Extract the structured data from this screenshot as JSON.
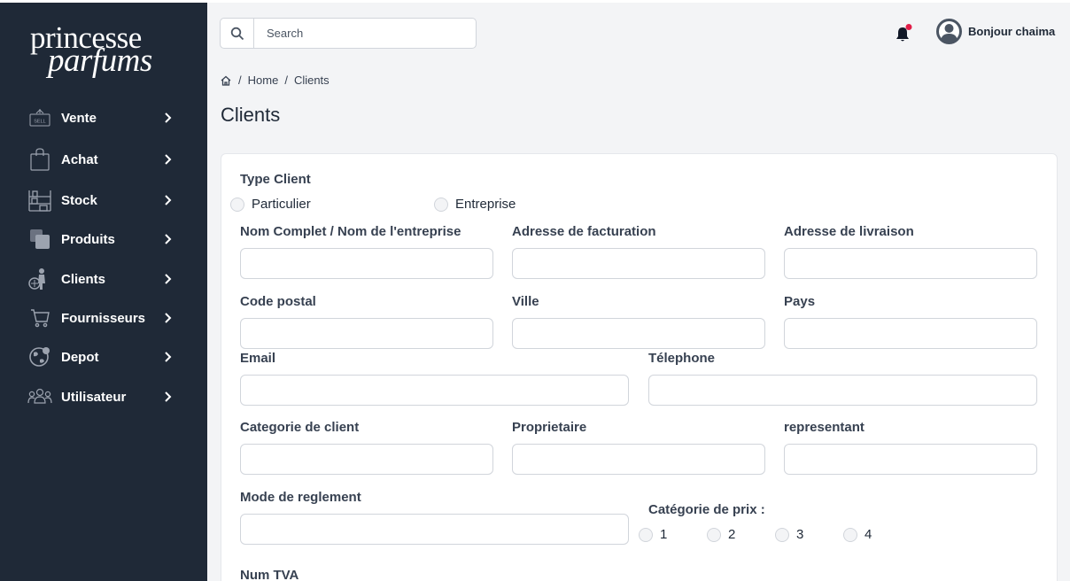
{
  "brand": {
    "line1": "princesse",
    "line2": "parfums"
  },
  "sidebar": {
    "items": [
      {
        "label": "Vente",
        "icon": "sell-sign-icon"
      },
      {
        "label": "Achat",
        "icon": "shopping-bag-icon"
      },
      {
        "label": "Stock",
        "icon": "shelves-icon"
      },
      {
        "label": "Produits",
        "icon": "products-icon"
      },
      {
        "label": "Clients",
        "icon": "clients-icon"
      },
      {
        "label": "Fournisseurs",
        "icon": "cart-icon"
      },
      {
        "label": "Depot",
        "icon": "globe-icon"
      },
      {
        "label": "Utilisateur",
        "icon": "users-icon"
      }
    ],
    "sell_badge": "SELL"
  },
  "header": {
    "search_placeholder": "Search",
    "user_greeting": "Bonjour chaima"
  },
  "breadcrumb": {
    "home": "Home",
    "current": "Clients"
  },
  "page_title": "Clients",
  "form": {
    "type_client_label": "Type Client",
    "type_options": [
      "Particulier",
      "Entreprise"
    ],
    "nom_label": "Nom Complet / Nom de l'entreprise",
    "adresse_facturation_label": "Adresse de facturation",
    "adresse_livraison_label": "Adresse de livraison",
    "code_postal_label": "Code postal",
    "ville_label": "Ville",
    "pays_label": "Pays",
    "email_label": "Email",
    "telephone_label": "Télephone",
    "categorie_client_label": "Categorie de client",
    "proprietaire_label": "Proprietaire",
    "representant_label": "representant",
    "mode_reglement_label": "Mode de reglement",
    "categorie_prix_label": "Catégorie de prix :",
    "prix_options": [
      "1",
      "2",
      "3",
      "4"
    ],
    "num_tva_label": "Num TVA"
  },
  "colors": {
    "sidebar_bg": "#1f2937",
    "page_bg": "#f3f4f6",
    "notification_dot": "#e11d48"
  }
}
